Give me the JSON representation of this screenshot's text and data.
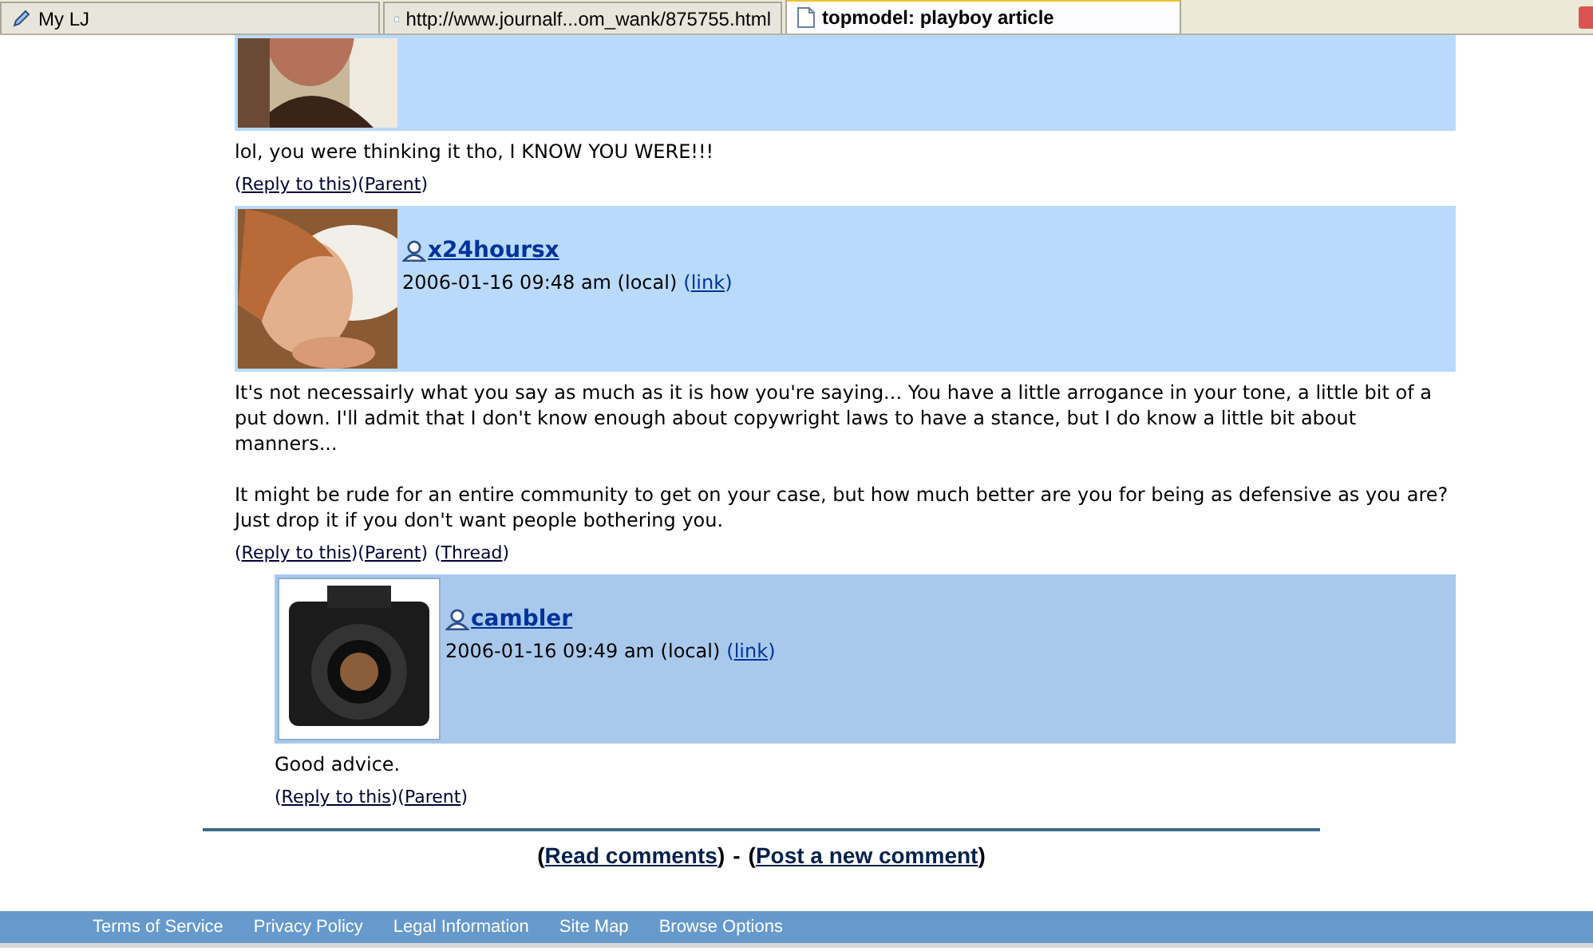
{
  "tabs": [
    {
      "label": "My LJ",
      "selected": false
    },
    {
      "label": "http://www.journalf...om_wank/875755.html",
      "selected": false
    },
    {
      "label": "topmodel: playboy article",
      "selected": true
    }
  ],
  "comments": [
    {
      "avatar": {
        "kind": "picture"
      },
      "body": [
        "lol, you were thinking it tho, I KNOW YOU WERE!!!"
      ],
      "actions": [
        "(Reply to this)",
        "(Parent)"
      ]
    },
    {
      "avatar": {
        "kind": "picture"
      },
      "username": "x24hoursx",
      "date": "2006-01-16 09:48 am (local)",
      "link": "(link)",
      "body": [
        "It's not necessairly what you say as much as it is how you're saying... You have a little arrogance in your tone, a little bit of a put down. I'll admit that I don't know enough about copywright laws to have a stance, but I do know a little bit about manners...",
        "It might be rude for an entire community to get on your case, but how much better are you for being as defensive as you are? Just drop it if you don't want people bothering you."
      ],
      "actions": [
        "(Reply to this)",
        "(Parent)",
        "(Thread)"
      ],
      "children": [
        {
          "avatar": {
            "kind": "picture"
          },
          "username": "cambler",
          "date": "2006-01-16 09:49 am (local)",
          "link": "(link)",
          "body": [
            "Good advice."
          ],
          "actions": [
            "(Reply to this)",
            "(Parent)"
          ]
        }
      ]
    }
  ],
  "bottom_links": [
    "(Read comments)",
    "-",
    "(Post a new comment)"
  ],
  "footer": [
    "Terms of Service",
    "Privacy Policy",
    "Legal Information",
    "Site Map",
    "Browse Options"
  ]
}
